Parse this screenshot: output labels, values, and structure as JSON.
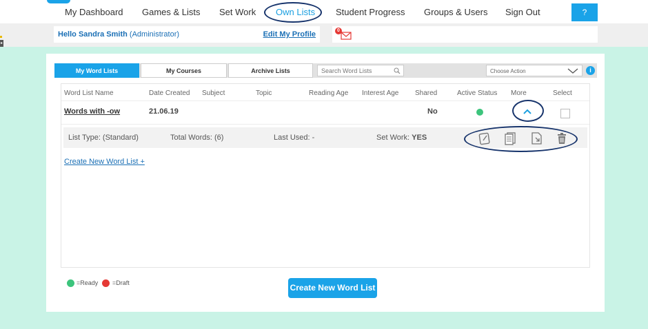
{
  "nav": {
    "items": [
      {
        "label": "My Dashboard"
      },
      {
        "label": "Games & Lists"
      },
      {
        "label": "Set Work"
      },
      {
        "label": "Own Lists"
      },
      {
        "label": "Student Progress"
      },
      {
        "label": "Groups & Users"
      },
      {
        "label": "Sign Out"
      }
    ],
    "help_label": "?"
  },
  "profile": {
    "hello": "Hello Sandra Smith",
    "role": "(Administrator)",
    "edit_label": "Edit My Profile",
    "message_count": "0"
  },
  "tabs": [
    {
      "label": "My Word Lists"
    },
    {
      "label": "My Courses"
    },
    {
      "label": "Archive Lists"
    }
  ],
  "search": {
    "placeholder": "Search Word Lists"
  },
  "action_select": {
    "value": "Choose Action"
  },
  "table": {
    "headers": [
      "Word List Name",
      "Date Created",
      "Subject",
      "Topic",
      "Reading Age",
      "Interest Age",
      "Shared",
      "Active Status",
      "More",
      "Select"
    ],
    "rows": [
      {
        "name": "Words with -ow",
        "date_created": "21.06.19",
        "subject": "",
        "topic": "",
        "reading_age": "",
        "interest_age": "",
        "shared": "No",
        "active_status": "ready"
      }
    ],
    "detail": {
      "list_type": "List Type: (Standard)",
      "total_words": "Total Words: (6)",
      "last_used": "Last Used: -",
      "set_work_label": "Set Work:",
      "set_work_value": "YES"
    }
  },
  "create_link": "Create New Word List +",
  "legend": {
    "ready": "=Ready",
    "draft": "=Draft"
  },
  "create_button": "Create New Word List",
  "colors": {
    "accent": "#1aa3e8",
    "ready": "#3cc47c",
    "draft": "#e53935",
    "background": "#c9f3e6",
    "highlight_circle": "#16336b"
  }
}
